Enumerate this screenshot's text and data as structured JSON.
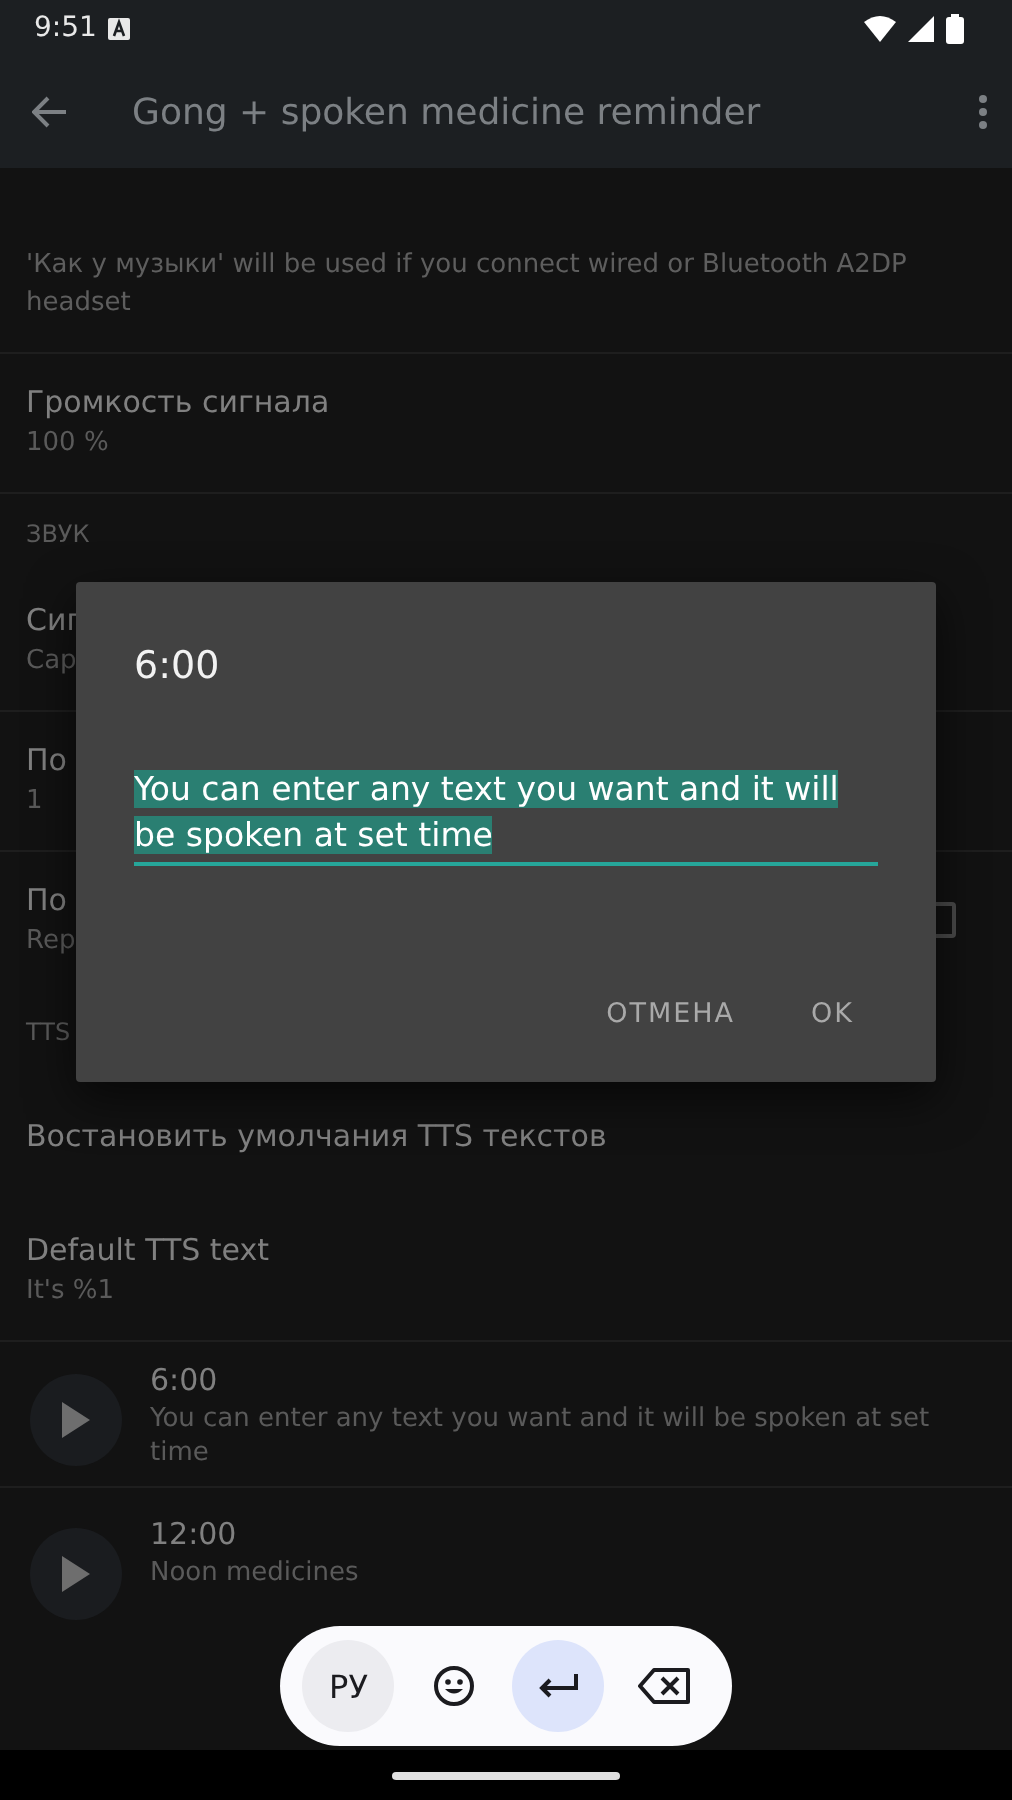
{
  "status_bar": {
    "time": "9:51"
  },
  "app_bar": {
    "title": "Gong + spoken medicine reminder"
  },
  "settings": [
    {
      "kind": "note",
      "text": "'Как у музыки' will be used if you connect wired or Bluetooth A2DP headset",
      "divider": true
    },
    {
      "kind": "pref",
      "title": "Громкость сигнала",
      "summary": "100 %",
      "divider": true
    },
    {
      "kind": "header",
      "text": "ЗВУК"
    },
    {
      "kind": "pref",
      "title": "Сиг",
      "summary": "Сар",
      "divider": true
    },
    {
      "kind": "pref",
      "title": "По",
      "summary": "1",
      "divider": true
    },
    {
      "kind": "check",
      "title": "По",
      "summary": "Rep",
      "checked": false,
      "divider": false
    },
    {
      "kind": "header",
      "text": "TTS"
    },
    {
      "kind": "pref",
      "title": "Востановить умолчания TTS текстов",
      "divider": false
    },
    {
      "kind": "pref",
      "title": "Default TTS text",
      "summary": "It's %1",
      "divider": true
    },
    {
      "kind": "speech",
      "title": "6:00",
      "summary": "You can enter any text you want and it will be spoken at set time",
      "divider": true
    },
    {
      "kind": "speech",
      "title": "12:00",
      "summary": "Noon medicines",
      "divider": false
    }
  ],
  "dialog": {
    "title": "6:00",
    "value": "You can enter any text you want and it will be spoken at set time",
    "selected": true,
    "buttons": [
      "ОТМЕНА",
      "OK"
    ]
  },
  "keyboard_toolbar": {
    "items": [
      {
        "kind": "text",
        "label": "РУ"
      },
      {
        "kind": "emoji"
      },
      {
        "kind": "enter"
      },
      {
        "kind": "backspace"
      }
    ]
  }
}
